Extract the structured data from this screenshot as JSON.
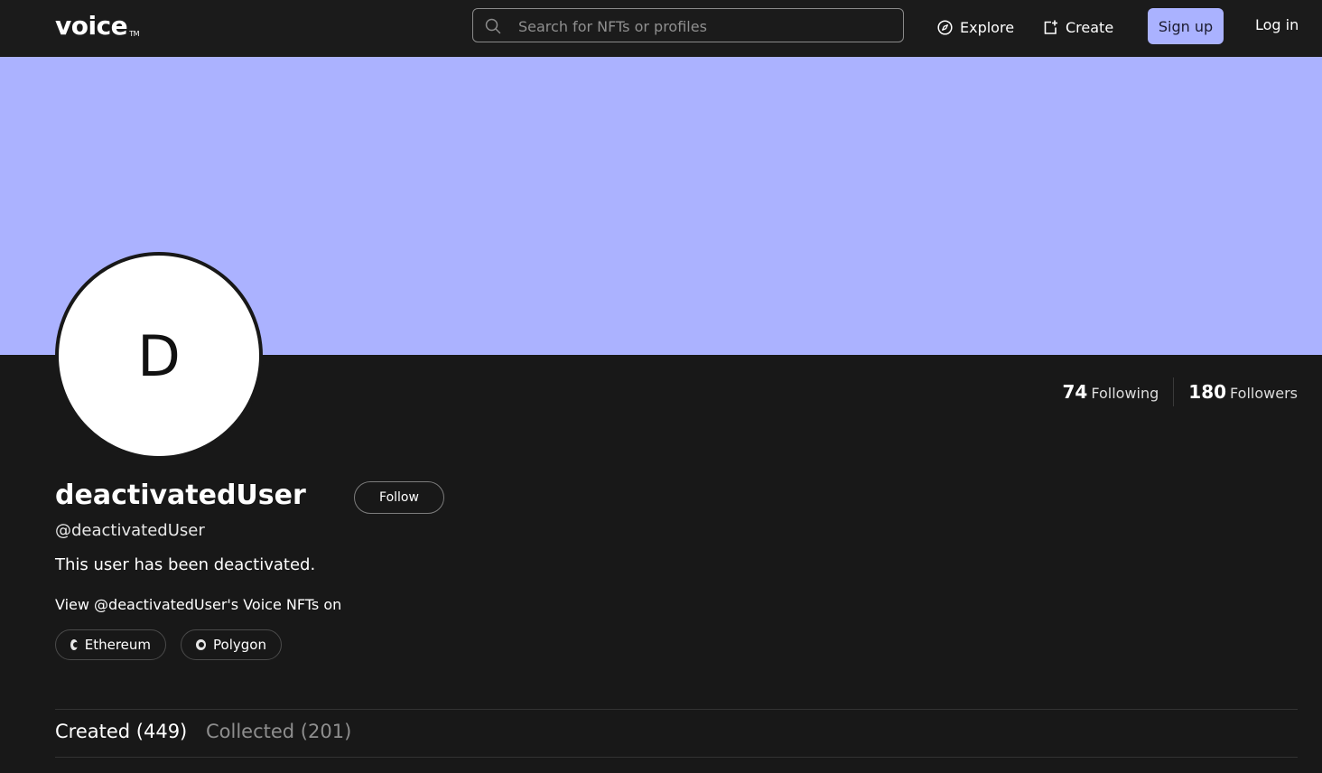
{
  "header": {
    "logo": "voice",
    "logo_tm": "TM",
    "search_placeholder": "Search for NFTs or profiles",
    "explore_label": "Explore",
    "create_label": "Create",
    "signup_label": "Sign up",
    "login_label": "Log in"
  },
  "colors": {
    "banner": "#abb2ff",
    "accent_button": "#aab2ff",
    "background": "#181818"
  },
  "profile": {
    "avatar_initial": "D",
    "display_name": "deactivatedUser",
    "handle": "@deactivatedUser",
    "bio": "This user has been deactivated.",
    "follow_label": "Follow",
    "view_label": "View @deactivatedUser's Voice NFTs on",
    "chains": [
      "Ethereum",
      "Polygon"
    ]
  },
  "stats": {
    "following_count": "74",
    "following_label": "Following",
    "followers_count": "180",
    "followers_label": "Followers"
  },
  "tabs": {
    "created": "Created (449)",
    "collected": "Collected (201)"
  }
}
